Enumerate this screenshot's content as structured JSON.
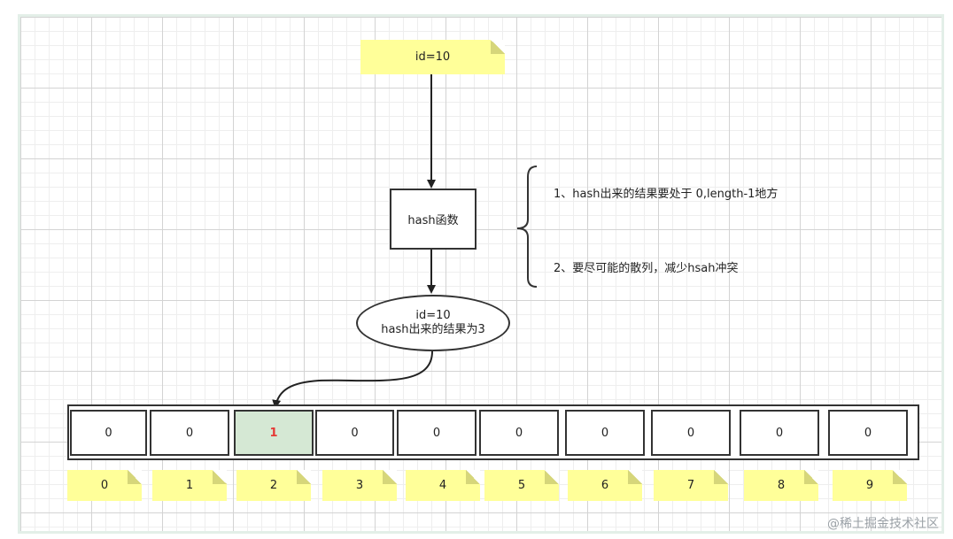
{
  "input_note": "id=10",
  "hash_box": "hash函数",
  "notes": {
    "line1": "1、hash出来的结果要处于 0,length-1地方",
    "line2": "2、要尽可能的散列，减少hsah冲突"
  },
  "result_ellipse": {
    "line1": "id=10",
    "line2": "hash出来的结果为3"
  },
  "array_cells": [
    "0",
    "0",
    "1",
    "0",
    "0",
    "0",
    "0",
    "0",
    "0",
    "0"
  ],
  "highlighted_index": 2,
  "index_labels": [
    "0",
    "1",
    "2",
    "3",
    "4",
    "5",
    "6",
    "7",
    "8",
    "9"
  ],
  "colors": {
    "note": "#ffff99",
    "highlight_fill": "#d5e8d4",
    "highlight_text": "#e53935"
  },
  "watermark": "@稀土掘金技术社区"
}
